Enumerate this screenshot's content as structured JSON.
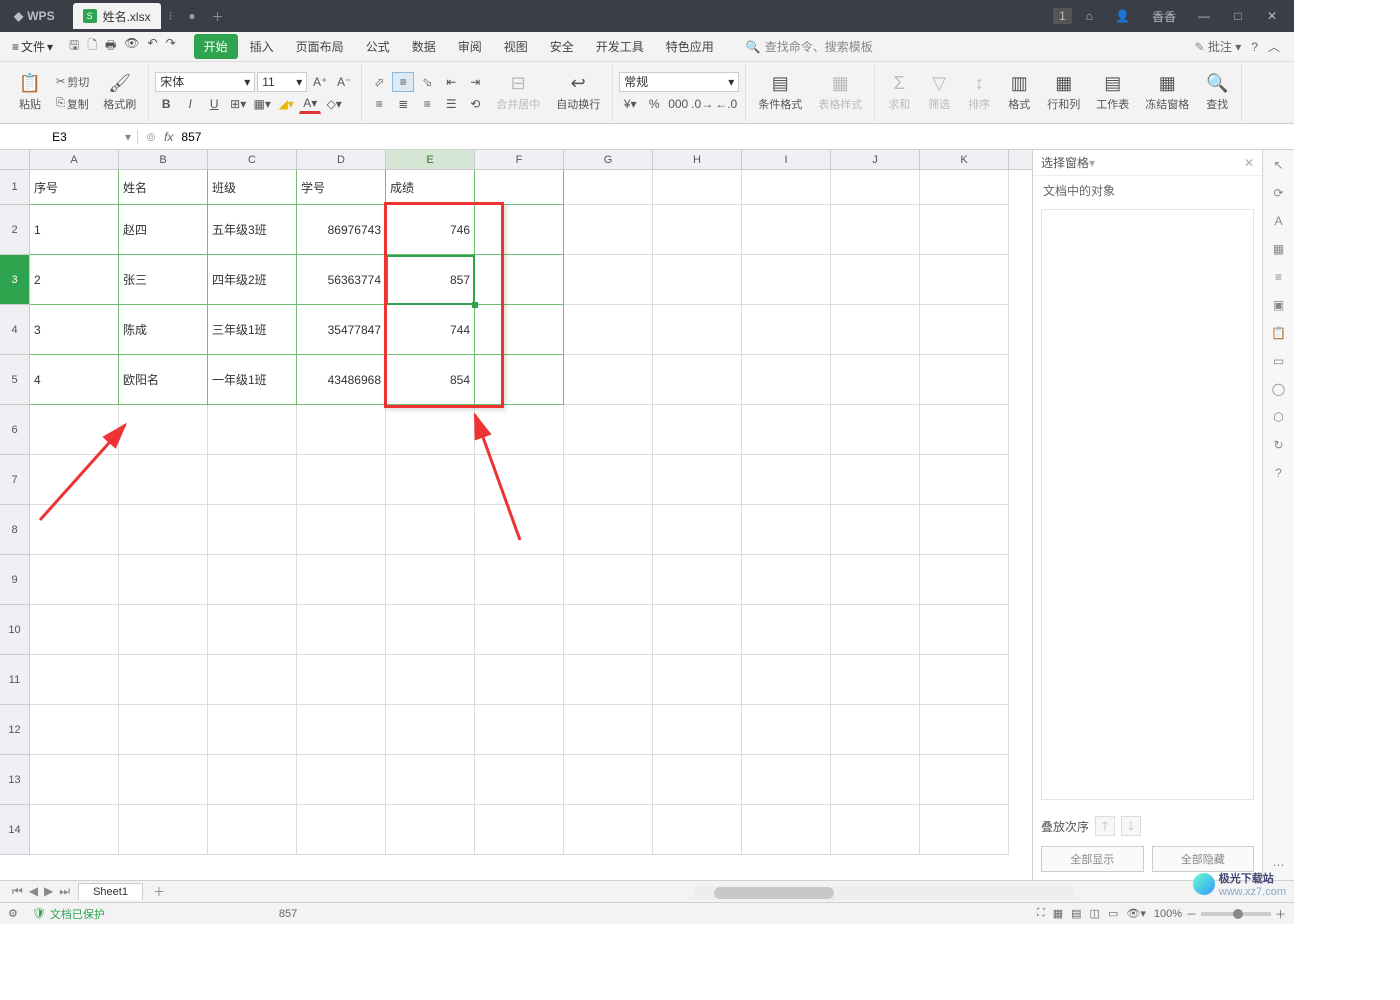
{
  "titlebar": {
    "app": "WPS",
    "tab_name": "姓名.xlsx",
    "user": "香香",
    "badge": "1"
  },
  "menubar": {
    "file": "文件",
    "tabs": [
      "开始",
      "插入",
      "页面布局",
      "公式",
      "数据",
      "审阅",
      "视图",
      "安全",
      "开发工具",
      "特色应用"
    ],
    "active_tab": "开始",
    "search_placeholder": "查找命令、搜索模板",
    "annotate": "批注"
  },
  "ribbon": {
    "paste": "粘贴",
    "cut": "剪切",
    "copy": "复制",
    "format_painter": "格式刷",
    "font_name": "宋体",
    "font_size": "11",
    "merge_center": "合并居中",
    "wrap": "自动换行",
    "number_format": "常规",
    "cond_format": "条件格式",
    "table_style": "表格样式",
    "sum": "求和",
    "filter": "筛选",
    "sort": "排序",
    "format": "格式",
    "row_col": "行和列",
    "worksheet": "工作表",
    "freeze": "冻结窗格",
    "find": "查找"
  },
  "namebox": {
    "ref": "E3"
  },
  "formula": {
    "value": "857"
  },
  "columns": [
    "A",
    "B",
    "C",
    "D",
    "E",
    "F",
    "G",
    "H",
    "I",
    "J",
    "K"
  ],
  "row_numbers": [
    "1",
    "2",
    "3",
    "4",
    "5",
    "6",
    "7",
    "8",
    "9",
    "10",
    "11",
    "12",
    "13",
    "14"
  ],
  "data": {
    "headers": [
      "序号",
      "姓名",
      "班级",
      "学号",
      "成绩"
    ],
    "rows": [
      {
        "seq": "1",
        "name": "赵四",
        "class": "五年级3班",
        "sid": "86976743",
        "score": "746"
      },
      {
        "seq": "2",
        "name": "张三",
        "class": "四年级2班",
        "sid": "56363774",
        "score": "857"
      },
      {
        "seq": "3",
        "name": "陈成",
        "class": "三年级1班",
        "sid": "35477847",
        "score": "744"
      },
      {
        "seq": "4",
        "name": "欧阳名",
        "class": "一年级1班",
        "sid": "43486968",
        "score": "854"
      }
    ]
  },
  "sidepanel": {
    "title": "选择窗格",
    "subtitle": "文档中的对象",
    "order": "叠放次序",
    "show_all": "全部显示",
    "hide_all": "全部隐藏"
  },
  "sheets": {
    "active": "Sheet1"
  },
  "statusbar": {
    "protected": "文档已保护",
    "value": "857",
    "zoom": "100%"
  },
  "watermark": {
    "text": "极光下载站",
    "url": "www.xz7.com"
  }
}
